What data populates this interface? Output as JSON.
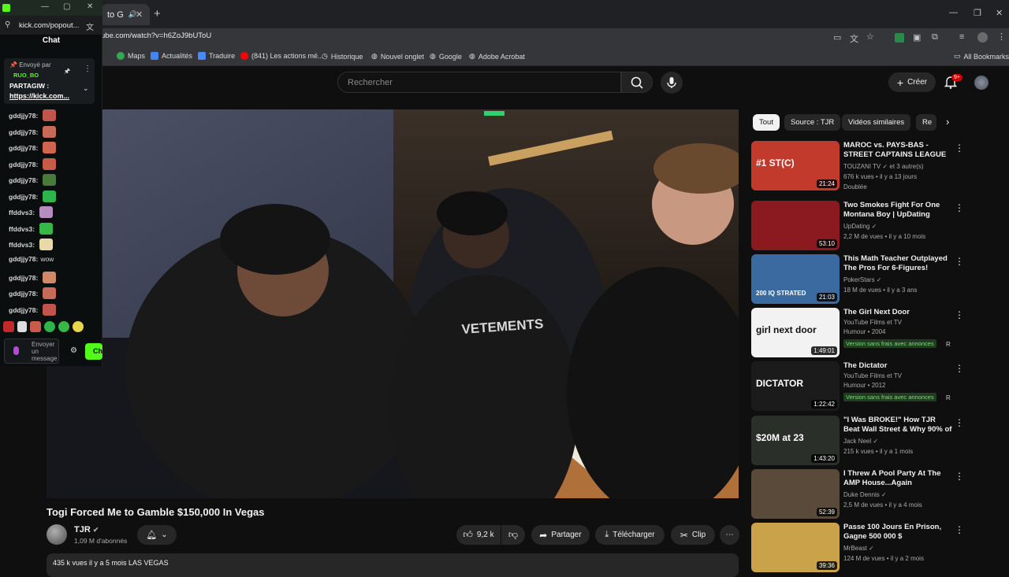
{
  "browser": {
    "tab_title": "to G",
    "url": "ube.com/watch?v=h6ZoJ9bUToU",
    "bookmarks": [
      "Maps",
      "Actualités",
      "Traduire",
      "(841) Les actions mé...",
      "Historique",
      "Nouvel onglet",
      "Google",
      "Adobe Acrobat"
    ],
    "all_bookmarks": "All Bookmarks"
  },
  "youtube": {
    "search_placeholder": "Rechercher",
    "create_label": "Créer",
    "notif_count": "9+"
  },
  "chat": {
    "url": "kick.com/popout...",
    "title": "Chat",
    "pinned_by_label": "Envoyé par",
    "pinned_user": "RUO_BO",
    "pinned_text": "PARTAGIW :",
    "pinned_link": "https://kick.com...",
    "messages": [
      {
        "user": "gddjjy78:",
        "text": "",
        "emote": "#c0554b"
      },
      {
        "user": "gddjjy78:",
        "text": "",
        "emote": "#c86a58"
      },
      {
        "user": "gddjjy78:",
        "text": "",
        "emote": "#d0654f"
      },
      {
        "user": "gddjjy78:",
        "text": "",
        "emote": "#c85a4a"
      },
      {
        "user": "gddjjy78:",
        "text": "",
        "emote": "#4a7a3a"
      },
      {
        "user": "gddjjy78:",
        "text": "",
        "emote": "#2fb34a"
      },
      {
        "user": "ffddvs3:",
        "text": "",
        "emote": "#b58cc0"
      },
      {
        "user": "ffddvs3:",
        "text": "",
        "emote": "#35b845"
      },
      {
        "user": "ffddvs3:",
        "text": "",
        "emote": "#e8d9a8"
      },
      {
        "user": "gddjjy78:",
        "text": "wow",
        "emote": ""
      },
      {
        "user": "gddjjy78:",
        "text": "",
        "emote": "#d08868"
      },
      {
        "user": "gddjjy78:",
        "text": "",
        "emote": "#c86a58"
      },
      {
        "user": "gddjjy78:",
        "text": "",
        "emote": "#c0554b"
      }
    ],
    "input_placeholder": "Envoyer un message",
    "send_label": "Ch"
  },
  "video": {
    "title": "Togi Forced Me to Gamble $150,000 In Vegas",
    "shirt_text": "VETEMENTS",
    "channel": "TJR",
    "subscribers": "1,09 M d'abonnés",
    "likes": "9,2 k",
    "share_label": "Partager",
    "download_label": "Télécharger",
    "clip_label": "Clip",
    "desc_meta": "435 k vues  il y a 5 mois  LAS VEGAS"
  },
  "sidebar": {
    "chips": [
      "Tout",
      "Source : TJR",
      "Vidéos similaires",
      "Re"
    ],
    "items": [
      {
        "title": "MAROC vs. PAYS-BAS - STREET CAPTAINS LEAGUE",
        "channel": "TOUZANI TV ✓ et 3 autre(s)",
        "meta": "676 k vues • il y a 13 jours",
        "extra": "Doublée",
        "duration": "21:24",
        "thumb": "#c23a2c",
        "thumb_text": "#1 ST(C)"
      },
      {
        "title": "Two Smokes Fight For One Montana Boy | UpDating",
        "channel": "UpDating ✓",
        "meta": "2,2 M de vues • il y a 10 mois",
        "extra": "",
        "duration": "53:10",
        "thumb": "#8a1a1f",
        "thumb_text": ""
      },
      {
        "title": "This Math Teacher Outplayed The Pros For 6-Figures!",
        "channel": "PokerStars ✓",
        "meta": "18 M de vues • il y a 3 ans",
        "extra": "",
        "duration": "21:03",
        "thumb": "#3a6aa0",
        "thumb_text": "200 IQ STRATED"
      },
      {
        "title": "The Girl Next Door",
        "channel": "YouTube Films et TV",
        "meta": "Humour • 2004",
        "extra": "Version sans frais avec annonces",
        "duration": "1:49:01",
        "thumb": "#f2f2f2",
        "thumb_text": "girl next door"
      },
      {
        "title": "The Dictator",
        "channel": "YouTube Films et TV",
        "meta": "Humour • 2012",
        "extra": "Version sans frais avec annonces",
        "duration": "1:22:42",
        "thumb": "#1b1b1b",
        "thumb_text": "DICTATOR"
      },
      {
        "title": "\"I Was BROKE!\" How TJR Beat Wall Street & Why 90% of ...",
        "channel": "Jack Neel ✓",
        "meta": "215 k vues • il y a 1 mois",
        "extra": "",
        "duration": "1:43:20",
        "thumb": "#2a2f2a",
        "thumb_text": "$20M at 23"
      },
      {
        "title": "I Threw A Pool Party At The AMP House...Again",
        "channel": "Duke Dennis ✓",
        "meta": "2,5 M de vues • il y a 4 mois",
        "extra": "",
        "duration": "52:39",
        "thumb": "#5a4a3a",
        "thumb_text": ""
      },
      {
        "title": "Passe 100 Jours En Prison, Gagne 500 000 $",
        "channel": "MrBeast ✓",
        "meta": "124 M de vues • il y a 2 mois",
        "extra": "",
        "duration": "39:36",
        "thumb": "#c9a24a",
        "thumb_text": ""
      }
    ]
  }
}
